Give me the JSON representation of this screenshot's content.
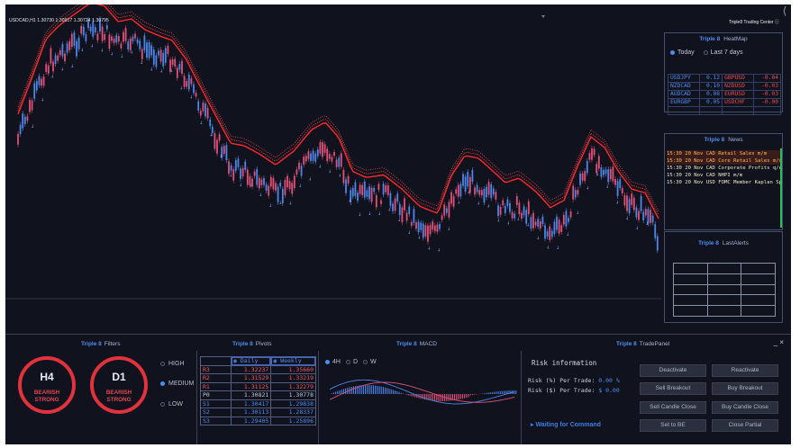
{
  "chart": {
    "symbol_info": "USDCAD,H1  1.30730 1.30917 1.30724 1.30795",
    "brand": "Triple8 Trading Center",
    "brand_icon": "info-circle-icon"
  },
  "heatmap": {
    "brand": "Triple 8",
    "title": "HeatMap",
    "options": [
      "Today",
      "Last 7 days"
    ],
    "selected_option": "Today",
    "rows": [
      [
        {
          "pair": "USDJPY",
          "value": "0.12",
          "dir": "up"
        },
        {
          "pair": "GBPUSD",
          "value": "-0.04",
          "dir": "dn"
        }
      ],
      [
        {
          "pair": "NZDCAD",
          "value": "0.10",
          "dir": "up"
        },
        {
          "pair": "NZDUSD",
          "value": "-0.03",
          "dir": "dn"
        }
      ],
      [
        {
          "pair": "AUDCAD",
          "value": "0.08",
          "dir": "up"
        },
        {
          "pair": "EURUSD",
          "value": "-0.03",
          "dir": "dn"
        }
      ],
      [
        {
          "pair": "EURGBP",
          "value": "0.05",
          "dir": "up"
        },
        {
          "pair": "USDCHF",
          "value": "-0.00",
          "dir": "dn"
        }
      ]
    ]
  },
  "news": {
    "brand": "Triple 8",
    "title": "News",
    "items": [
      "15:30 20 Nov CAD Retail Sales m/m",
      "15:30 20 Nov CAD Core Retail Sales m/m",
      "15:30 20 Nov CAD Corporate Profits q/q",
      "15:30 20 Nov CAD NHPI m/m",
      "15:30 20 Nov USD FOMC Member Kaplan Speaks"
    ]
  },
  "alerts": {
    "brand": "Triple 8",
    "title": "LastAlerts"
  },
  "filters": {
    "brand": "Triple 8",
    "title": "Filters",
    "gauges": [
      {
        "timeframe": "H4",
        "signal_line1": "BEARISH",
        "signal_line2": "STRONG"
      },
      {
        "timeframe": "D1",
        "signal_line1": "BEARISH",
        "signal_line2": "STRONG"
      }
    ],
    "levels": [
      "HIGH",
      "MEDIUM",
      "LOW"
    ],
    "selected_level": "MEDIUM"
  },
  "pivots": {
    "brand": "Triple 8",
    "title": "Pivots",
    "headers": [
      "Daily",
      "Weekly"
    ],
    "rows": [
      {
        "label": "R3",
        "daily": "1.32237",
        "weekly": "1.35660",
        "kind": "r"
      },
      {
        "label": "R2",
        "daily": "1.31529",
        "weekly": "1.33219",
        "kind": "r"
      },
      {
        "label": "R1",
        "daily": "1.31125",
        "weekly": "1.32279",
        "kind": "r"
      },
      {
        "label": "P0",
        "daily": "1.30821",
        "weekly": "1.30778",
        "kind": "p"
      },
      {
        "label": "S1",
        "daily": "1.30417",
        "weekly": "1.29838",
        "kind": "s"
      },
      {
        "label": "S2",
        "daily": "1.30113",
        "weekly": "1.28337",
        "kind": "s"
      },
      {
        "label": "S3",
        "daily": "1.29405",
        "weekly": "1.25896",
        "kind": "s"
      }
    ]
  },
  "macd": {
    "brand": "Triple 8",
    "title": "MACD",
    "timeframes": [
      "4H",
      "D",
      "W"
    ],
    "selected": "4H"
  },
  "tradepanel": {
    "brand": "Triple 8",
    "title": "TradePanel",
    "close_label": "_ ×",
    "risk_title": "Risk information",
    "risk_pct_label": "Risk (%) Per Trade:",
    "risk_pct_value": "0.00 %",
    "risk_usd_label": "Risk ($) Per Trade:",
    "risk_usd_value": "$ 0.00",
    "status": "▸  Waiting for Command",
    "buttons": [
      "Deactivate",
      "Reactivate",
      "Sell Breakout",
      "Buy Breakout",
      "Sell Candle Close",
      "Buy Candle Close",
      "Set to BE",
      "Close Partial"
    ]
  }
}
